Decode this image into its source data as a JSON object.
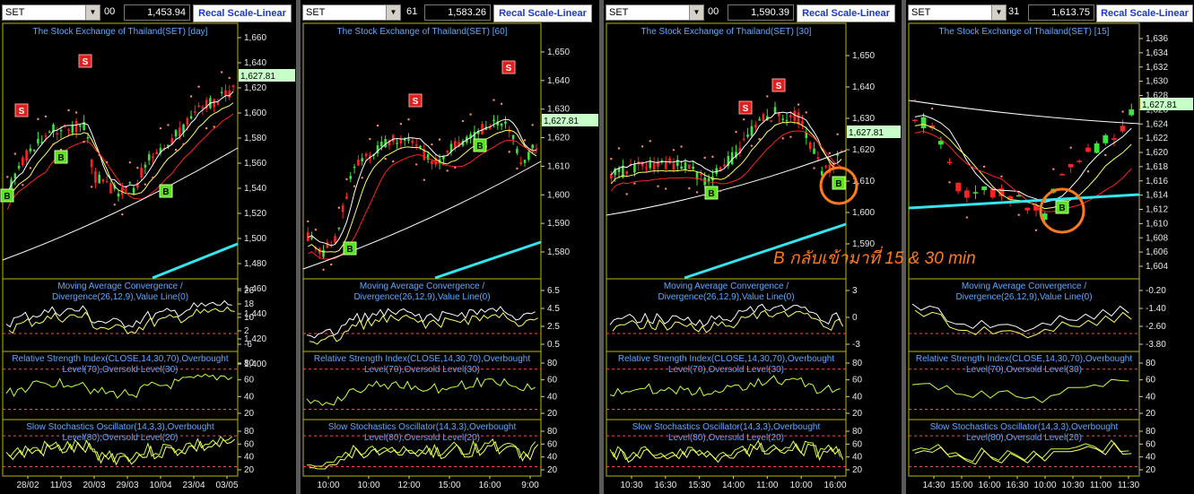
{
  "window": {
    "title": "SET multi-timeframe chart"
  },
  "annotation": {
    "text": "B กลับเข้ามาที่ 15 & 30 min",
    "color": "#ff7a1a"
  },
  "colors": {
    "mid_line": "#ffff66",
    "long_ma": "#ffffff",
    "short_ma": "#ff2222",
    "trend_line": "#33e5ee",
    "up_candle": "#3fe23f",
    "down_candle": "#ff2222",
    "buy_marker": "#5be321",
    "sell_marker": "#e0201e"
  },
  "panels": [
    {
      "symbol": "SET",
      "stub": "00",
      "price": "1,453.94",
      "recal": "Recal Scale-Linear",
      "title": "The Stock Exchange of Thailand(SET) [day]",
      "last_price": "1,627.81",
      "y_ticks": [
        "1,660",
        "1,640",
        "1,620",
        "1,600",
        "1,580",
        "1,560",
        "1,540",
        "1,520",
        "1,500",
        "1,480",
        "1,460",
        "1,440",
        "1,420",
        "1,400"
      ],
      "x_ticks": [
        "28/02",
        "11/03",
        "20/03",
        "29/03",
        "10/04",
        "23/04",
        "03/05"
      ],
      "macd": {
        "l1": "Moving Average Convergence /",
        "l2": "Divergence(26,12,9),Value Line(0)",
        "ticks": [
          "26",
          "18",
          "10",
          "2",
          "-6"
        ]
      },
      "rsi": {
        "l1": "Relative Strength Index(CLOSE,14,30,70),Overbought",
        "l2": "Level(70),Oversold Level(30)",
        "ticks": [
          "80",
          "60",
          "40",
          "20"
        ]
      },
      "stoch": {
        "l1": "Slow Stochastics Oscillator(14,3,3),Overbought",
        "l2": "Level(80),Oversold Level(20)",
        "ticks": [
          "80",
          "60",
          "40",
          "20"
        ]
      },
      "markers": [
        {
          "type": "S",
          "label": "S"
        },
        {
          "type": "S",
          "label": "S"
        },
        {
          "type": "B",
          "label": "B"
        },
        {
          "type": "B",
          "label": "B"
        },
        {
          "type": "B",
          "label": "B"
        }
      ]
    },
    {
      "symbol": "SET",
      "stub": "61",
      "price": "1,583.26",
      "recal": "Recal Scale-Linear",
      "title": "The Stock Exchange of Thailand(SET) [60]",
      "last_price": "1,627.81",
      "y_ticks": [
        "1,650",
        "1,640",
        "1,630",
        "1,620",
        "1,610",
        "1,600",
        "1,590",
        "1,580"
      ],
      "x_ticks": [
        "10:00",
        "10:00",
        "12:00",
        "15:00",
        "16:00",
        "9:00"
      ],
      "macd": {
        "l1": "Moving Average Convergence /",
        "l2": "Divergence(26,12,9),Value Line(0)",
        "ticks": [
          "6.5",
          "4.5",
          "2.5",
          "0.5"
        ]
      },
      "rsi": {
        "l1": "Relative Strength Index(CLOSE,14,30,70),Overbought",
        "l2": "Level(70),Oversold Level(30)",
        "ticks": [
          "80",
          "60",
          "40",
          "20"
        ]
      },
      "stoch": {
        "l1": "Slow Stochastics Oscillator(14,3,3),Overbought",
        "l2": "Level(80),Oversold Level(20)",
        "ticks": [
          "80",
          "60",
          "40",
          "20"
        ]
      },
      "markers": [
        {
          "type": "S",
          "label": "S"
        },
        {
          "type": "S",
          "label": "S"
        },
        {
          "type": "B",
          "label": "B"
        },
        {
          "type": "B",
          "label": "B"
        }
      ]
    },
    {
      "symbol": "SET",
      "stub": "00",
      "price": "1,590.39",
      "recal": "Recal Scale-Linear",
      "title": "The Stock Exchange of Thailand(SET) [30]",
      "last_price": "1,627.81",
      "y_ticks": [
        "1,650",
        "1,640",
        "1,630",
        "1,620",
        "1,610",
        "1,600",
        "1,590"
      ],
      "x_ticks": [
        "10:30",
        "16:30",
        "15:30",
        "14:00",
        "11:00",
        "10:00",
        "16:00"
      ],
      "macd": {
        "l1": "Moving Average Convergence /",
        "l2": "Divergence(26,12,9),Value Line(0)",
        "ticks": [
          "3",
          "0",
          "-3"
        ]
      },
      "rsi": {
        "l1": "Relative Strength Index(CLOSE,14,30,70),Overbought",
        "l2": "Level(70),Oversold Level(30)",
        "ticks": [
          "80",
          "60",
          "40",
          "20"
        ]
      },
      "stoch": {
        "l1": "Slow Stochastics Oscillator(14,3,3),Overbought",
        "l2": "Level(80),Oversold Level(20)",
        "ticks": [
          "80",
          "60",
          "40",
          "20"
        ]
      },
      "markers": [
        {
          "type": "S",
          "label": "S"
        },
        {
          "type": "S",
          "label": "S"
        },
        {
          "type": "B",
          "label": "B"
        },
        {
          "type": "B",
          "label": "B"
        }
      ]
    },
    {
      "symbol": "SET",
      "stub": "31",
      "price": "1,613.75",
      "recal": "Recal Scale-Linear",
      "title": "The Stock Exchange of Thailand(SET) [15]",
      "last_price": "1,627.81",
      "y_ticks": [
        "1,636",
        "1,634",
        "1,632",
        "1,630",
        "1,628",
        "1,626",
        "1,624",
        "1,622",
        "1,620",
        "1,618",
        "1,616",
        "1,614",
        "1,612",
        "1,610",
        "1,608",
        "1,606",
        "1,604"
      ],
      "x_ticks": [
        "14:30",
        "15:00",
        "16:00",
        "16:30",
        "10:00",
        "10:30",
        "11:00",
        "11:30"
      ],
      "macd": {
        "l1": "Moving Average Convergence /",
        "l2": "Divergence(26,12,9),Value Line(0)",
        "ticks": [
          "-0.20",
          "-1.40",
          "-2.60",
          "-3.80"
        ]
      },
      "rsi": {
        "l1": "Relative Strength Index(CLOSE,14,30,70),Overbought",
        "l2": "Level(70),Oversold Level(30)",
        "ticks": [
          "80",
          "60",
          "40",
          "20"
        ]
      },
      "stoch": {
        "l1": "Slow Stochastics Oscillator(14,3,3),Overbought",
        "l2": "Level(80),Oversold Level(20)",
        "ticks": [
          "80",
          "60",
          "40",
          "20"
        ]
      },
      "markers": [
        {
          "type": "B",
          "label": "B"
        }
      ]
    }
  ]
}
